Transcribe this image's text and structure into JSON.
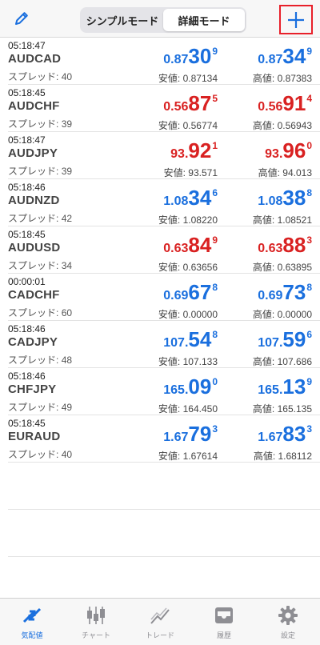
{
  "header": {
    "segments": [
      {
        "label": "シンプルモード",
        "active": false
      },
      {
        "label": "詳細モード",
        "active": true
      }
    ],
    "edit_icon": "pencil-icon",
    "add_icon": "plus-icon",
    "accent_color": "#1a6fde",
    "highlight_color": "#e8202a"
  },
  "spread_label": "スプレッド:",
  "low_label": "安値:",
  "high_label": "高値:",
  "quotes": [
    {
      "time": "05:18:47",
      "symbol": "AUDCAD",
      "spread": "40",
      "bid": {
        "pre": "0.87",
        "big": "30",
        "sup": "9",
        "color": "blue"
      },
      "ask": {
        "pre": "0.87",
        "big": "34",
        "sup": "9",
        "color": "blue"
      },
      "low": "0.87134",
      "high": "0.87383"
    },
    {
      "time": "05:18:45",
      "symbol": "AUDCHF",
      "spread": "39",
      "bid": {
        "pre": "0.56",
        "big": "87",
        "sup": "5",
        "color": "red"
      },
      "ask": {
        "pre": "0.56",
        "big": "91",
        "sup": "4",
        "color": "red"
      },
      "low": "0.56774",
      "high": "0.56943"
    },
    {
      "time": "05:18:47",
      "symbol": "AUDJPY",
      "spread": "39",
      "bid": {
        "pre": "93.",
        "big": "92",
        "sup": "1",
        "color": "red"
      },
      "ask": {
        "pre": "93.",
        "big": "96",
        "sup": "0",
        "color": "red"
      },
      "low": "93.571",
      "high": "94.013"
    },
    {
      "time": "05:18:46",
      "symbol": "AUDNZD",
      "spread": "42",
      "bid": {
        "pre": "1.08",
        "big": "34",
        "sup": "6",
        "color": "blue"
      },
      "ask": {
        "pre": "1.08",
        "big": "38",
        "sup": "8",
        "color": "blue"
      },
      "low": "1.08220",
      "high": "1.08521"
    },
    {
      "time": "05:18:45",
      "symbol": "AUDUSD",
      "spread": "34",
      "bid": {
        "pre": "0.63",
        "big": "84",
        "sup": "9",
        "color": "red"
      },
      "ask": {
        "pre": "0.63",
        "big": "88",
        "sup": "3",
        "color": "red"
      },
      "low": "0.63656",
      "high": "0.63895"
    },
    {
      "time": "00:00:01",
      "symbol": "CADCHF",
      "spread": "60",
      "bid": {
        "pre": "0.69",
        "big": "67",
        "sup": "8",
        "color": "blue"
      },
      "ask": {
        "pre": "0.69",
        "big": "73",
        "sup": "8",
        "color": "blue"
      },
      "low": "0.00000",
      "high": "0.00000"
    },
    {
      "time": "05:18:46",
      "symbol": "CADJPY",
      "spread": "48",
      "bid": {
        "pre": "107.",
        "big": "54",
        "sup": "8",
        "color": "blue"
      },
      "ask": {
        "pre": "107.",
        "big": "59",
        "sup": "6",
        "color": "blue"
      },
      "low": "107.133",
      "high": "107.686"
    },
    {
      "time": "05:18:46",
      "symbol": "CHFJPY",
      "spread": "49",
      "bid": {
        "pre": "165.",
        "big": "09",
        "sup": "0",
        "color": "blue"
      },
      "ask": {
        "pre": "165.",
        "big": "13",
        "sup": "9",
        "color": "blue"
      },
      "low": "164.450",
      "high": "165.135"
    },
    {
      "time": "05:18:45",
      "symbol": "EURAUD",
      "spread": "40",
      "bid": {
        "pre": "1.67",
        "big": "79",
        "sup": "3",
        "color": "blue"
      },
      "ask": {
        "pre": "1.67",
        "big": "83",
        "sup": "3",
        "color": "blue"
      },
      "low": "1.67614",
      "high": "1.68112"
    }
  ],
  "tabs": [
    {
      "label": "気配値",
      "icon": "quotes-arrows-icon",
      "active": true
    },
    {
      "label": "チャート",
      "icon": "candlestick-chart-icon",
      "active": false
    },
    {
      "label": "トレード",
      "icon": "trade-line-icon",
      "active": false
    },
    {
      "label": "履歴",
      "icon": "history-inbox-icon",
      "active": false
    },
    {
      "label": "設定",
      "icon": "gear-icon",
      "active": false
    }
  ]
}
